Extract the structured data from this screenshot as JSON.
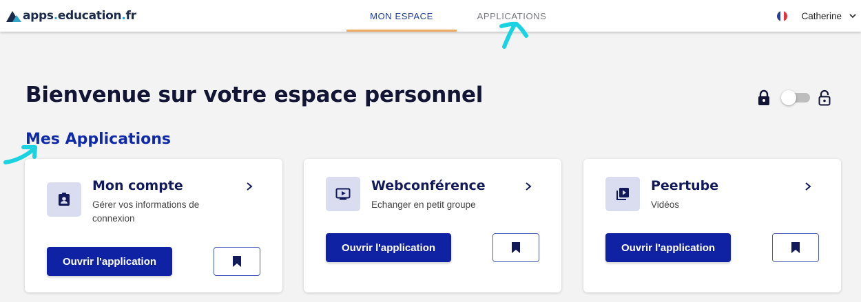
{
  "header": {
    "logo": {
      "part1": "apps",
      "dot1": ".",
      "part2": "education",
      "dot2": ".",
      "part3": "fr"
    },
    "tabs": [
      {
        "label": "MON ESPACE",
        "active": true
      },
      {
        "label": "APPLICATIONS",
        "active": false
      }
    ],
    "user": {
      "name": "Catherine",
      "flag_icon": "france-flag-icon",
      "chevron_icon": "chevron-down-icon"
    }
  },
  "main": {
    "title": "Bienvenue sur votre espace personnel",
    "lock_toggle": {
      "locked_icon": "lock-closed-icon",
      "unlocked_icon": "lock-open-icon",
      "on": false
    },
    "section_title": "Mes Applications",
    "cards": [
      {
        "title": "Mon compte",
        "description": "Gérer vos informations de connexion",
        "icon": "contact-badge-icon",
        "button_label": "Ouvrir l'application",
        "bookmark_icon": "bookmark-icon"
      },
      {
        "title": "Webconférence",
        "description": "Echanger en petit groupe",
        "icon": "video-screen-icon",
        "button_label": "Ouvrir l'application",
        "bookmark_icon": "bookmark-icon"
      },
      {
        "title": "Peertube",
        "description": "Vidéos",
        "icon": "video-library-icon",
        "button_label": "Ouvrir l'application",
        "bookmark_icon": "bookmark-icon"
      }
    ]
  },
  "colors": {
    "primary": "#1022a4",
    "title": "#121533",
    "tab_underline": "#f0a961",
    "icon_bg": "#dadcf0",
    "annotation": "#19d3e0"
  }
}
